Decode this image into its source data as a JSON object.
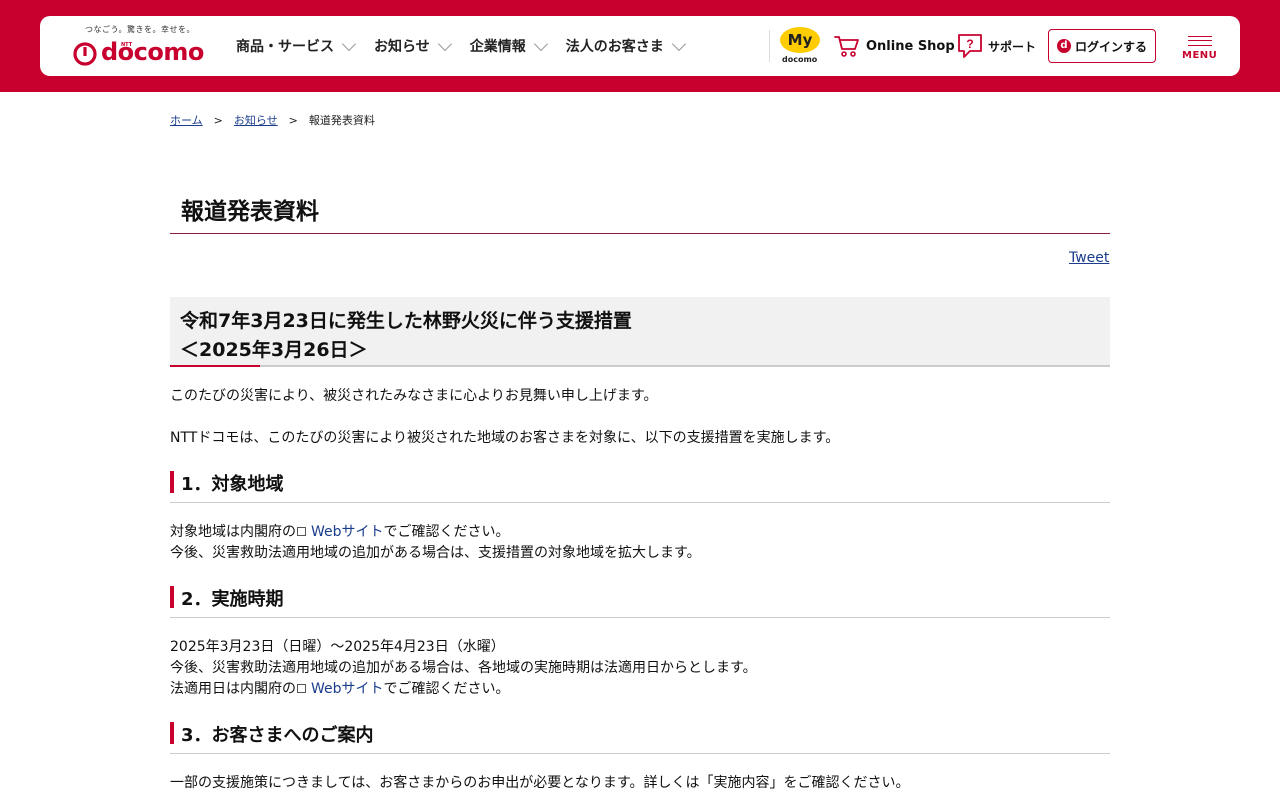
{
  "header": {
    "logo_tagline": "つなごう。驚きを。幸せを。",
    "logo_ntt": "NTT",
    "logo_text": "docomo",
    "nav": [
      {
        "label": "商品・サービス"
      },
      {
        "label": "お知らせ"
      },
      {
        "label": "企業情報"
      },
      {
        "label": "法人のお客さま"
      }
    ],
    "my_label": "My",
    "my_sub": "docomo",
    "shop_label": "Online Shop",
    "support_label": "サポート",
    "login_icon": "d",
    "login_label": "ログインする",
    "menu_label": "MENU"
  },
  "breadcrumb": [
    {
      "label": "ホーム"
    },
    {
      "label": "お知らせ"
    },
    {
      "label": "報道発表資料"
    }
  ],
  "page_title": "報道発表資料",
  "tweet_label": "Tweet",
  "notice": {
    "title": "令和7年3月23日に発生した林野火災に伴う支援措置",
    "date": "＜2025年3月26日＞"
  },
  "intro": [
    "このたびの災害により、被災されたみなさまに心よりお見舞い申し上げます。",
    "NTTドコモは、このたびの災害により被災された地域のお客さまを対象に、以下の支援措置を実施します。"
  ],
  "sections": [
    {
      "title": "1．対象地域",
      "line1_prefix": "対象地域は内閣府の",
      "line1_link": "Webサイト",
      "line1_suffix": "でご確認ください。",
      "line2": "今後、災害救助法適用地域の追加がある場合は、支援措置の対象地域を拡大します。"
    },
    {
      "title": "2．実施時期",
      "line1": "2025年3月23日（日曜）～2025年4月23日（水曜）",
      "line2": "今後、災害救助法適用地域の追加がある場合は、各地域の実施時期は法適用日からとします。",
      "line3_prefix": "法適用日は内閣府の",
      "line3_link": "Webサイト",
      "line3_suffix": "でご確認ください。"
    },
    {
      "title": "3．お客さまへのご案内",
      "line1": "一部の支援施策につきましては、お客さまからのお申出が必要となります。詳しくは「実施内容」をご確認ください。"
    }
  ],
  "colors": {
    "brand": "#c8002e",
    "link": "#1a3d8c",
    "my_badge": "#ffcc00"
  },
  "icons": {
    "cart": "shopping-cart-icon",
    "support": "question-bubble-icon",
    "external": "external-link-icon",
    "menu": "hamburger-icon"
  }
}
